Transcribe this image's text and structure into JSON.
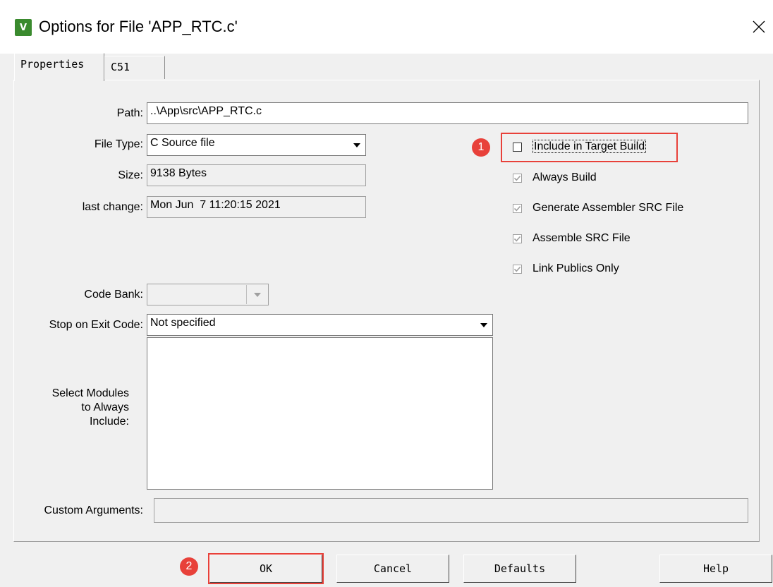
{
  "window": {
    "title": "Options for File 'APP_RTC.c'",
    "icon": "keil-uvision-icon",
    "close_icon": "close-icon"
  },
  "tabs": [
    {
      "label": "Properties",
      "active": true
    },
    {
      "label": "C51",
      "active": false
    }
  ],
  "properties": {
    "path_label": "Path:",
    "path_value": "..\\App\\src\\APP_RTC.c",
    "file_type_label": "File Type:",
    "file_type_value": "C Source file",
    "size_label": "Size:",
    "size_value": "9138 Bytes",
    "last_change_label": "last change:",
    "last_change_value": "Mon Jun  7 11:20:15 2021",
    "code_bank_label": "Code Bank:",
    "code_bank_value": "",
    "stop_exit_label": "Stop on Exit Code:",
    "stop_exit_value": "Not specified",
    "select_modules_label_1": "Select Modules",
    "select_modules_label_2": "to Always",
    "select_modules_label_3": "Include:",
    "custom_args_label": "Custom Arguments:",
    "custom_args_value": ""
  },
  "options": {
    "include_target_build": {
      "label": "Include in Target Build",
      "checked": false,
      "enabled": true
    },
    "always_build": {
      "label": "Always Build",
      "checked": true,
      "enabled": false
    },
    "generate_asm_src": {
      "label": "Generate Assembler SRC File",
      "checked": true,
      "enabled": false
    },
    "assemble_src": {
      "label": "Assemble SRC File",
      "checked": true,
      "enabled": false
    },
    "link_publics": {
      "label": "Link Publics Only",
      "checked": true,
      "enabled": false
    }
  },
  "annotations": {
    "marker_1": "1",
    "marker_2": "2",
    "highlight_color": "#e8413a"
  },
  "buttons": {
    "ok": "OK",
    "cancel": "Cancel",
    "defaults": "Defaults",
    "help": "Help"
  }
}
